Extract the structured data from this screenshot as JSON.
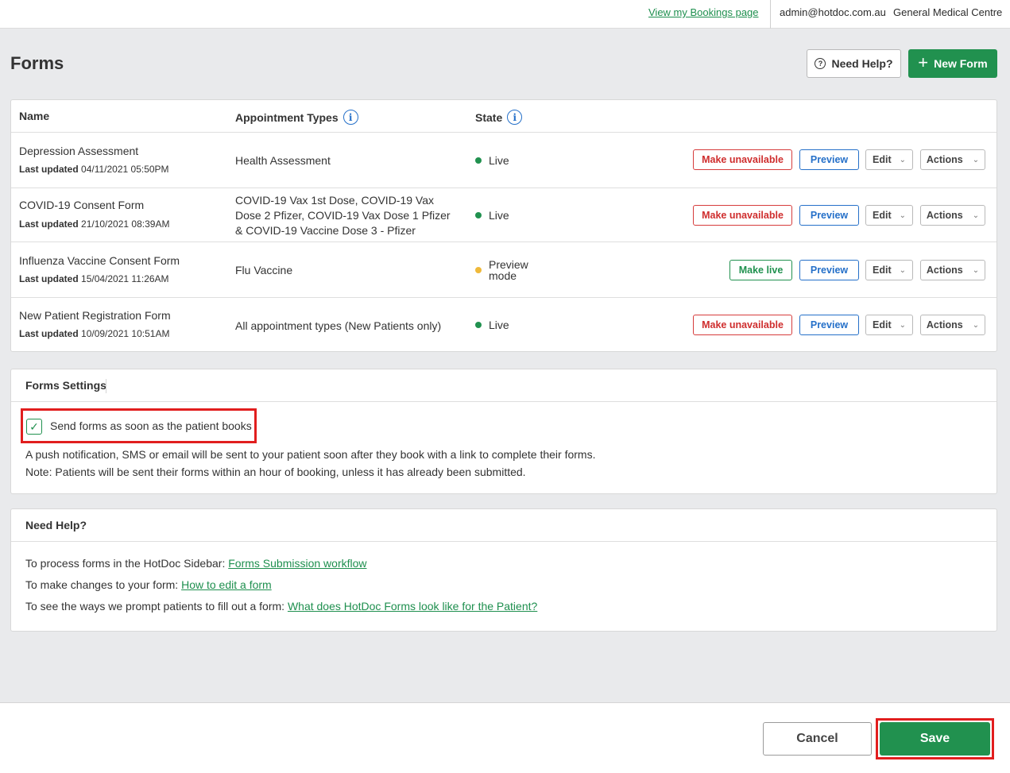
{
  "topbar": {
    "bookings_link": "View my Bookings page",
    "user_email": "admin@hotdoc.com.au",
    "clinic_name": "General Medical Centre"
  },
  "page": {
    "title": "Forms",
    "need_help_button": "Need Help?",
    "new_form_button": "New Form"
  },
  "table": {
    "headers": {
      "name": "Name",
      "appointment_types": "Appointment Types",
      "state": "State"
    },
    "last_updated_label": "Last updated",
    "rows": [
      {
        "name": "Depression Assessment",
        "last_updated": "04/11/2021 05:50PM",
        "appointment_types": "Health Assessment",
        "state": "Live",
        "primary_action": "Make unavailable",
        "preview": "Preview",
        "edit": "Edit",
        "actions": "Actions"
      },
      {
        "name": "COVID-19 Consent Form",
        "last_updated": "21/10/2021 08:39AM",
        "appointment_types": "COVID-19 Vax 1st Dose, COVID-19 Vax Dose 2 Pfizer, COVID-19 Vax Dose 1 Pfizer & COVID-19 Vaccine Dose 3 - Pfizer",
        "state": "Live",
        "primary_action": "Make unavailable",
        "preview": "Preview",
        "edit": "Edit",
        "actions": "Actions"
      },
      {
        "name": "Influenza Vaccine Consent Form",
        "last_updated": "15/04/2021 11:26AM",
        "appointment_types": "Flu Vaccine",
        "state_line1": "Preview",
        "state_line2": "mode",
        "primary_action": "Make live",
        "preview": "Preview",
        "edit": "Edit",
        "actions": "Actions"
      },
      {
        "name": "New Patient Registration Form",
        "last_updated": "10/09/2021 10:51AM",
        "appointment_types": "All appointment types (New Patients only)",
        "state": "Live",
        "primary_action": "Make unavailable",
        "preview": "Preview",
        "edit": "Edit",
        "actions": "Actions"
      }
    ]
  },
  "settings": {
    "title": "Forms Settings",
    "checkbox_label": "Send forms as soon as the patient books",
    "checkbox_checked": true,
    "description_1": "A push notification, SMS or email will be sent to your patient soon after they book with a link to complete their forms.",
    "description_2": "Note: Patients will be sent their forms within an hour of booking, unless it has already been submitted."
  },
  "help": {
    "title": "Need Help?",
    "lines": [
      {
        "text": "To process forms in the HotDoc Sidebar: ",
        "link": "Forms Submission workflow"
      },
      {
        "text": "To make changes to your form: ",
        "link": "How to edit a form"
      },
      {
        "text": "To see the ways we prompt patients to fill out a form: ",
        "link": "What does HotDoc Forms look like for the Patient?"
      }
    ]
  },
  "footer": {
    "cancel": "Cancel",
    "save": "Save"
  },
  "colors": {
    "brand_green": "#21914f",
    "danger_red": "#cf2e2e",
    "preview_blue": "#2570c9",
    "preview_mode_dot": "#efb93a",
    "highlight_red": "#e11e1e"
  },
  "icons": {
    "help": "question-circle-icon",
    "new_form": "plus-icon",
    "info": "info-circle-icon",
    "dropdown": "chevron-down-icon",
    "checkbox": "check-icon"
  }
}
